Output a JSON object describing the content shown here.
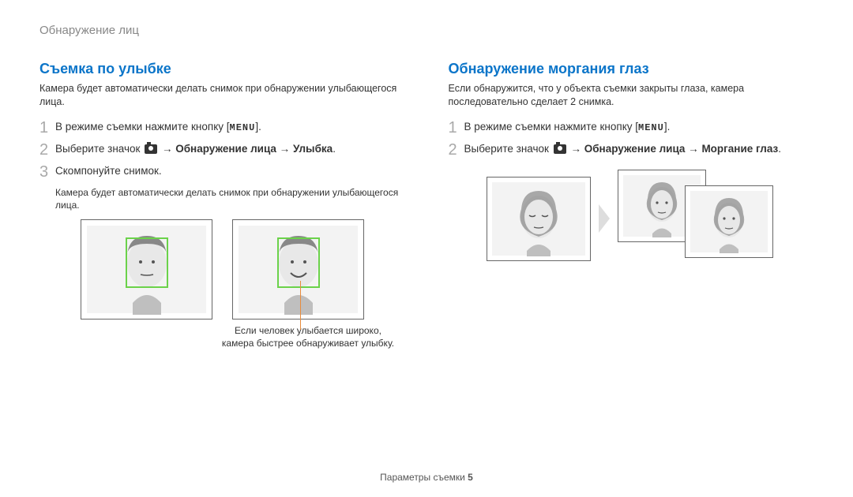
{
  "breadcrumb": "Обнаружение лиц",
  "left": {
    "heading": "Съемка по улыбке",
    "intro": "Камера будет автоматически делать снимок при обнаружении улыбающегося лица.",
    "step1_pre": "В режиме съемки нажмите кнопку [",
    "menu": "MENU",
    "step1_post": "].",
    "step2_pre": "Выберите значок ",
    "step2_arrow1": " → ",
    "step2_b1": "Обнаружение лица",
    "step2_arrow2": " → ",
    "step2_b2": "Улыбка",
    "step2_end": ".",
    "step3": "Скомпонуйте снимок.",
    "step3_sub": "Камера будет автоматически делать снимок при обнаружении улыбающегося лица.",
    "callout": "Если человек улыбается широко, камера быстрее обнаруживает улыбку."
  },
  "right": {
    "heading": "Обнаружение моргания глаз",
    "intro": "Если обнаружится, что у объекта съемки закрыты глаза, камера последовательно сделает 2 снимка.",
    "step1_pre": "В режиме съемки нажмите кнопку [",
    "menu": "MENU",
    "step1_post": "].",
    "step2_pre": "Выберите значок ",
    "step2_arrow1": " → ",
    "step2_b1": "Обнаружение лица",
    "step2_arrow2": " → ",
    "step2_b2": "Моргание глаз",
    "step2_end": "."
  },
  "footer_label": "Параметры съемки  ",
  "footer_page": "5",
  "chart_data": null
}
